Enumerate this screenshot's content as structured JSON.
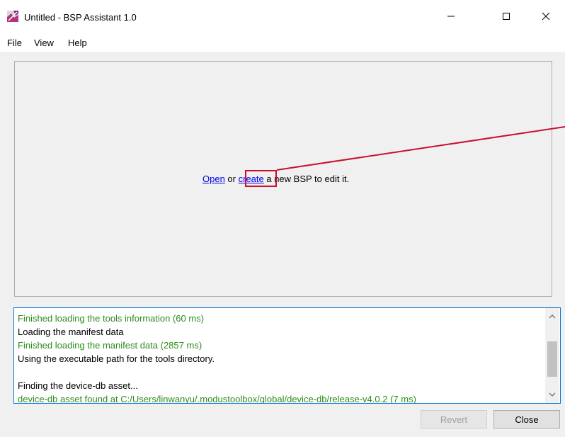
{
  "window": {
    "title": "Untitled - BSP Assistant 1.0"
  },
  "menu": {
    "items": [
      "File",
      "View",
      "Help"
    ]
  },
  "editor": {
    "open_link": "Open",
    "or_text": " or ",
    "create_link": "create",
    "rest_text": " a new BSP to edit it."
  },
  "log": {
    "lines": [
      {
        "text": "Finished loading the tools information (60 ms)",
        "color": "green"
      },
      {
        "text": "Loading the manifest data",
        "color": "black"
      },
      {
        "text": "Finished loading the manifest data (2857 ms)",
        "color": "green"
      },
      {
        "text": "Using the executable path for the tools directory.",
        "color": "black"
      },
      {
        "text": "",
        "color": "black"
      },
      {
        "text": "Finding the device-db asset...",
        "color": "black"
      },
      {
        "text": "device-db asset found at C:/Users/linwanyu/.modustoolbox/global/device-db/release-v4.0.2 (7 ms)",
        "color": "green"
      }
    ]
  },
  "buttons": {
    "revert": "Revert",
    "close": "Close"
  },
  "colors": {
    "log_green": "#2e8b1e",
    "link_blue": "#0000ee",
    "annotation_red": "#c8102e",
    "focus_blue": "#0078d7"
  }
}
